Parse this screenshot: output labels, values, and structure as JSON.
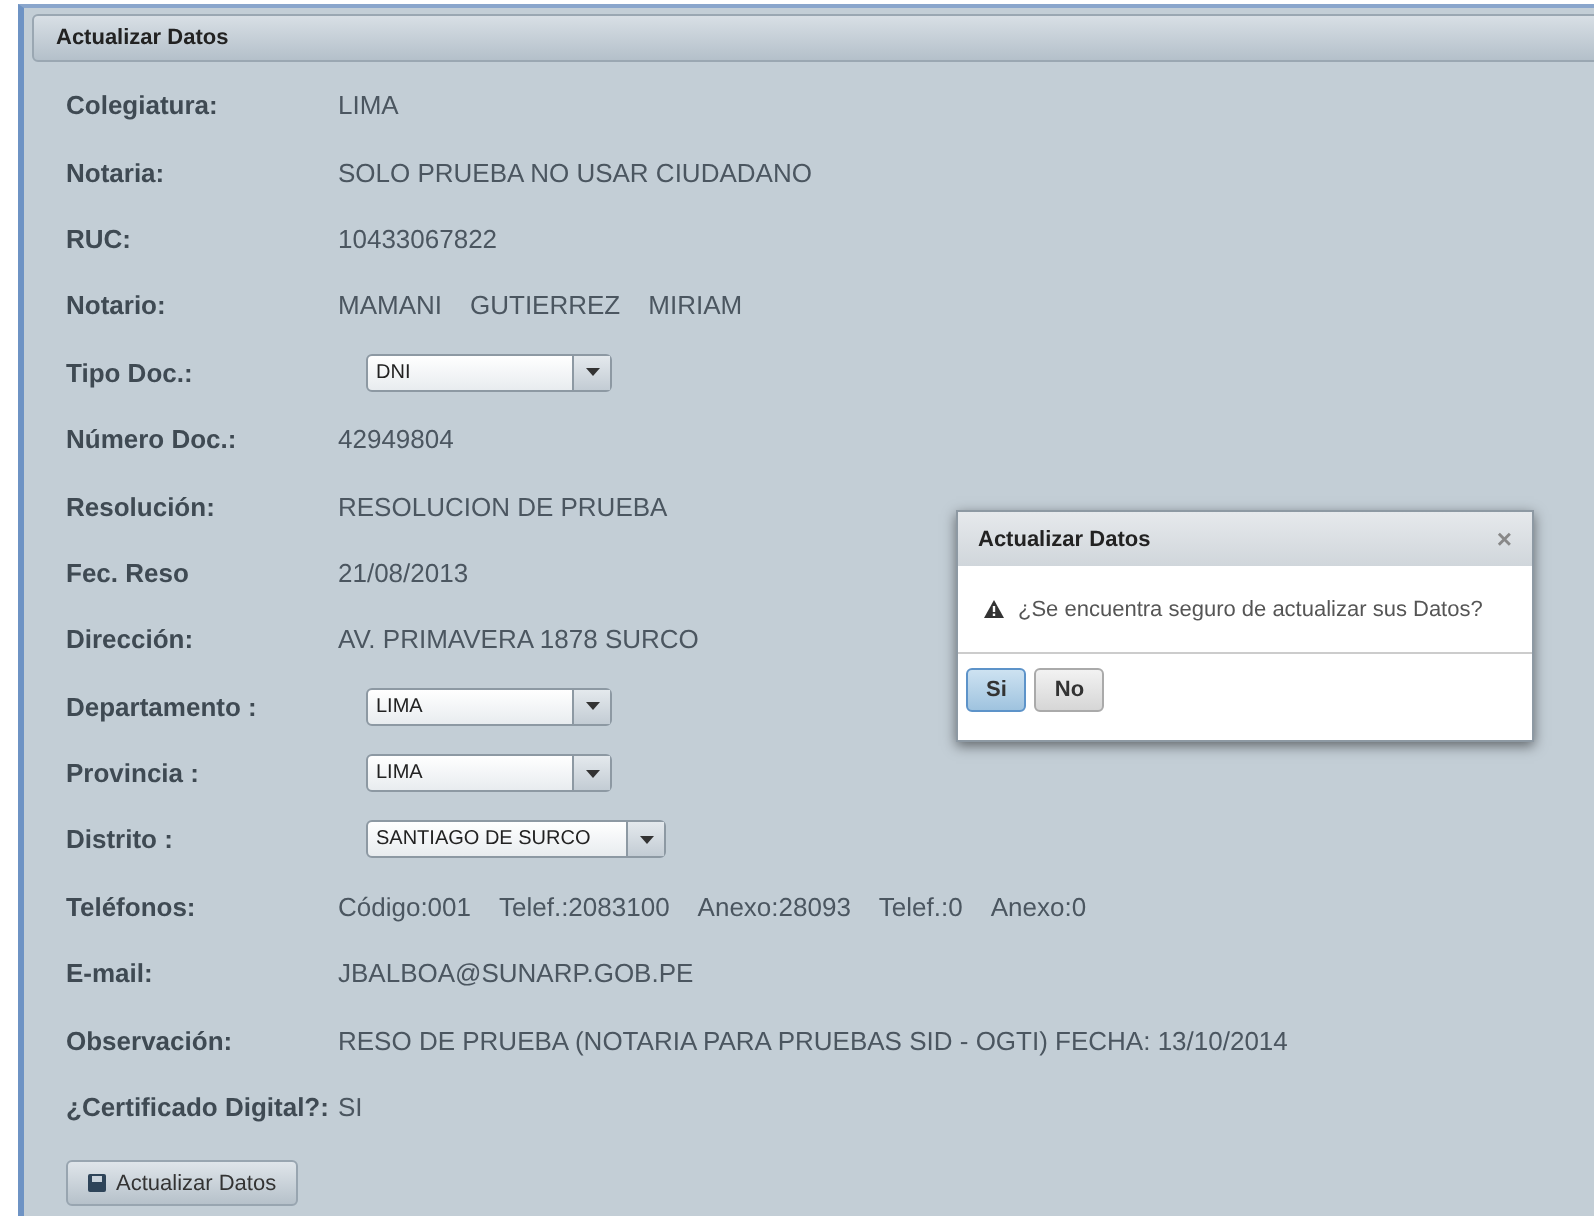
{
  "panel": {
    "title": "Actualizar Datos"
  },
  "fields": [
    {
      "kind": "text",
      "label": "Colegiatura:",
      "parts": [
        "LIMA"
      ]
    },
    {
      "kind": "text",
      "label": "Notaria:",
      "parts": [
        "SOLO PRUEBA NO USAR CIUDADANO"
      ]
    },
    {
      "kind": "text",
      "label": "RUC:",
      "parts": [
        "10433067822"
      ]
    },
    {
      "kind": "text",
      "label": "Notario:",
      "parts": [
        "MAMANI",
        "GUTIERREZ",
        "MIRIAM"
      ]
    },
    {
      "kind": "select",
      "label": "Tipo Doc.:",
      "value": "DNI"
    },
    {
      "kind": "text",
      "label": "Número Doc.:",
      "parts": [
        "42949804"
      ]
    },
    {
      "kind": "text",
      "label": "Resolución:",
      "parts": [
        "RESOLUCION DE PRUEBA"
      ]
    },
    {
      "kind": "text",
      "label": "Fec. Reso",
      "parts": [
        "21/08/2013"
      ]
    },
    {
      "kind": "text",
      "label": "Dirección:",
      "parts": [
        "AV. PRIMAVERA 1878 SURCO"
      ]
    },
    {
      "kind": "select",
      "label": "Departamento :",
      "value": "LIMA"
    },
    {
      "kind": "select",
      "label": "Provincia :",
      "value": "LIMA"
    },
    {
      "kind": "select",
      "label": "Distrito :",
      "value": "SANTIAGO DE SURCO"
    },
    {
      "kind": "text",
      "label": "Teléfonos:",
      "parts": [
        "Código:001",
        "Telef.:2083100",
        "Anexo:28093",
        "Telef.:0",
        "Anexo:0"
      ]
    },
    {
      "kind": "text",
      "label": "E-mail:",
      "parts": [
        "JBALBOA@SUNARP.GOB.PE"
      ]
    },
    {
      "kind": "text",
      "label": "Observación:",
      "parts": [
        "RESO DE PRUEBA (NOTARIA PARA PRUEBAS SID - OGTI) FECHA: 13/10/2014"
      ]
    },
    {
      "kind": "text",
      "label": "¿Certificado Digital?:",
      "parts": [
        "SI"
      ]
    }
  ],
  "submit": {
    "label": "Actualizar Datos"
  },
  "dialog": {
    "title": "Actualizar Datos",
    "close": "×",
    "message": "¿Se encuentra seguro de actualizar sus Datos?",
    "buttons": [
      {
        "label": "Si",
        "selected": true
      },
      {
        "label": "No",
        "selected": false
      }
    ]
  }
}
